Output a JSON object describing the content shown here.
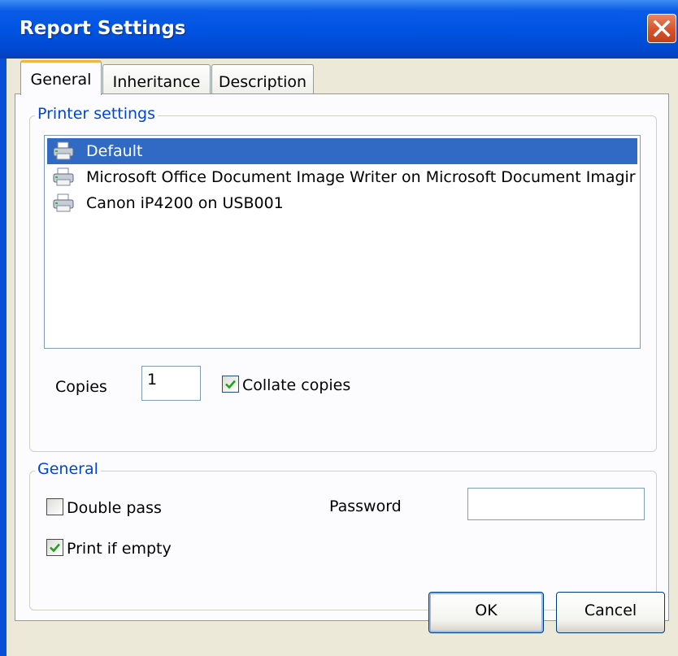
{
  "window": {
    "title": "Report Settings"
  },
  "tabs": [
    {
      "label": "General",
      "active": true
    },
    {
      "label": "Inheritance",
      "active": false
    },
    {
      "label": "Description",
      "active": false
    }
  ],
  "printer_settings": {
    "legend": "Printer settings",
    "printers": [
      {
        "name": "Default",
        "selected": true,
        "icon": "printer-icon"
      },
      {
        "name": "Microsoft Office Document Image Writer on Microsoft Document Imagir",
        "selected": false,
        "icon": "printer-icon"
      },
      {
        "name": "Canon iP4200 on USB001",
        "selected": false,
        "icon": "printer-icon"
      }
    ],
    "copies_label": "Copies",
    "copies_value": "1",
    "collate_label": "Collate copies",
    "collate_checked": true
  },
  "general": {
    "legend": "General",
    "double_pass_label": "Double pass",
    "double_pass_checked": false,
    "print_if_empty_label": "Print if empty",
    "print_if_empty_checked": true,
    "password_label": "Password",
    "password_value": ""
  },
  "buttons": {
    "ok": "OK",
    "cancel": "Cancel"
  },
  "colors": {
    "title_bar": "#0054e3",
    "selection": "#316ac5",
    "legend_text": "#0046d5",
    "dialog_bg": "#ece9d8",
    "check_mark": "#21a121"
  }
}
